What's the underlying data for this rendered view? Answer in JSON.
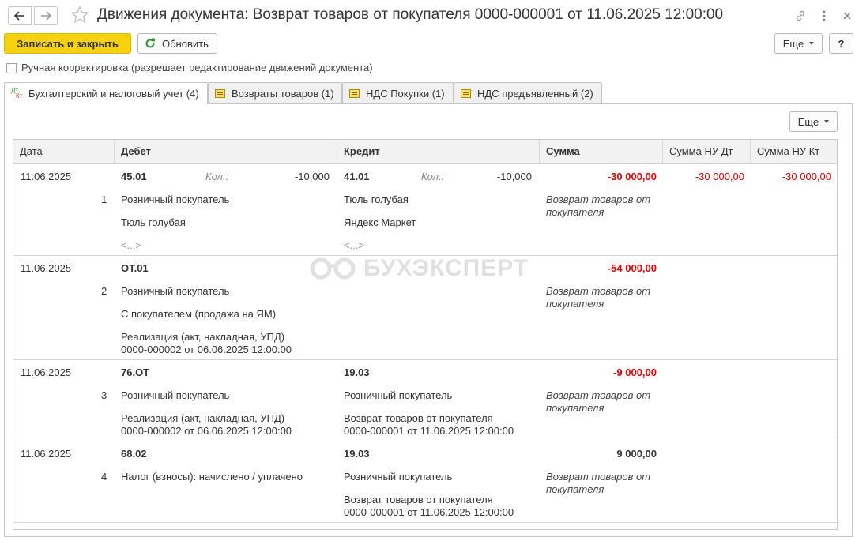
{
  "window": {
    "title": "Движения документа: Возврат товаров от покупателя 0000-000001 от 11.06.2025 12:00:00"
  },
  "toolbar": {
    "save_close": "Записать и закрыть",
    "refresh": "Обновить",
    "more": "Еще",
    "help": "?"
  },
  "manual_edit": {
    "label": "Ручная корректировка (разрешает редактирование движений документа)",
    "checked": false
  },
  "tabs": [
    {
      "label": "Бухгалтерский и налоговый учет (4)",
      "icon": "dt-kt-icon",
      "active": true
    },
    {
      "label": "Возвраты товаров (1)",
      "icon": "register-icon",
      "active": false
    },
    {
      "label": "НДС Покупки (1)",
      "icon": "register-icon",
      "active": false
    },
    {
      "label": "НДС предъявленный (2)",
      "icon": "register-icon",
      "active": false
    }
  ],
  "panel": {
    "more": "Еще"
  },
  "watermark": "БУХЭКСПЕРТ",
  "table": {
    "headers": {
      "date": "Дата",
      "debit": "Дебет",
      "credit": "Кредит",
      "sum": "Сумма",
      "sum_nu_dt": "Сумма НУ Дт",
      "sum_nu_kt": "Сумма НУ Кт"
    },
    "rows": [
      {
        "date": "11.06.2025",
        "n": "1",
        "debit_account": "45.01",
        "debit_kol_label": "Кол.:",
        "debit_kol": "-10,000",
        "debit_sub1": "Розничный покупатель",
        "debit_sub2": "Тюль голубая",
        "debit_sub3": "<...>",
        "credit_account": "41.01",
        "credit_kol_label": "Кол.:",
        "credit_kol": "-10,000",
        "credit_sub1": "Тюль голубая",
        "credit_sub2": "Яндекс Маркет",
        "credit_sub3": "<...>",
        "sum": "-30 000,00",
        "content": "Возврат товаров от покупателя",
        "sum_nu_dt": "-30 000,00",
        "sum_nu_kt": "-30 000,00"
      },
      {
        "date": "11.06.2025",
        "n": "2",
        "debit_account": "ОТ.01",
        "debit_sub1": "Розничный покупатель",
        "debit_sub2": "С покупателем (продажа на ЯМ)",
        "debit_sub3a": "Реализация (акт, накладная, УПД)",
        "debit_sub3b": "0000-000002 от 06.06.2025 12:00:00",
        "sum": "-54 000,00",
        "content": "Возврат товаров от покупателя"
      },
      {
        "date": "11.06.2025",
        "n": "3",
        "debit_account": "76.ОТ",
        "debit_sub1": "Розничный покупатель",
        "debit_sub2a": "Реализация (акт, накладная, УПД)",
        "debit_sub2b": "0000-000002 от 06.06.2025 12:00:00",
        "credit_account": "19.03",
        "credit_sub1": "Розничный покупатель",
        "credit_sub2a": "Возврат товаров от покупателя",
        "credit_sub2b": "0000-000001 от 11.06.2025 12:00:00",
        "sum": "-9 000,00",
        "content": "Возврат товаров от покупателя"
      },
      {
        "date": "11.06.2025",
        "n": "4",
        "debit_account": "68.02",
        "debit_sub1": "Налог (взносы): начислено / уплачено",
        "credit_account": "19.03",
        "credit_sub1": "Розничный покупатель",
        "credit_sub2a": "Возврат товаров от покупателя",
        "credit_sub2b": "0000-000001 от 11.06.2025 12:00:00",
        "sum": "9 000,00",
        "content": "Возврат товаров от покупателя"
      }
    ]
  },
  "colors": {
    "primary_button": "#f5d20d",
    "negative_amount": "#e00000",
    "tab_active": "#ffffff",
    "tab_inactive": "#f0f0f0"
  }
}
